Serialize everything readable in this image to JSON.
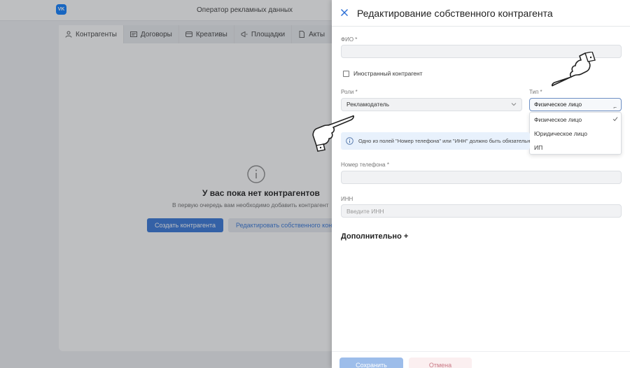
{
  "app": {
    "title": "Оператор рекламных данных",
    "logo": "VK",
    "tabs": [
      {
        "label": "Контрагенты",
        "icon": "user-icon"
      },
      {
        "label": "Договоры",
        "icon": "contract-icon"
      },
      {
        "label": "Креативы",
        "icon": "creative-icon"
      },
      {
        "label": "Площадки",
        "icon": "megaphone-icon"
      },
      {
        "label": "Акты",
        "icon": "document-icon"
      }
    ],
    "empty": {
      "icon": "info-icon",
      "title": "У вас пока нет контрагентов",
      "subtitle": "В первую очередь вам необходимо добавить контрагент",
      "create_button": "Создать контрагента",
      "edit_own_button": "Редактировать собственного контрагента"
    }
  },
  "drawer": {
    "title": "Редактирование собственного контрагента",
    "fio": {
      "label": "ФИО *",
      "value": ""
    },
    "foreign": {
      "label": "Иностранный контрагент",
      "checked": false
    },
    "roles": {
      "label": "Роли *",
      "value": "Рекламодатель"
    },
    "type": {
      "label": "Тип *",
      "value": "Физическое лицо",
      "options": [
        "Физическое лицо",
        "Юридическое лицо",
        "ИП"
      ],
      "selected_index": 0
    },
    "info_text": "Одно из полей \"Номер телефона\" или \"ИНН\" должно быть обязательно заполнено",
    "phone": {
      "label": "Номер телефона *",
      "value": ""
    },
    "inn": {
      "label": "ИНН",
      "placeholder": "Введите ИНН"
    },
    "more_label": "Дополнительно +",
    "save_label": "Сохранить",
    "cancel_label": "Отмена"
  },
  "colors": {
    "accent": "#2b6fd6",
    "save_disabled": "#9dbdea",
    "banner": "#e8f1fc"
  }
}
